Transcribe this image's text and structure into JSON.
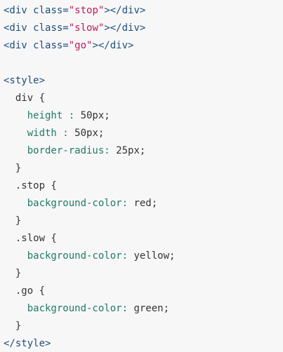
{
  "code": {
    "lines": [
      {
        "indent": "",
        "tag_open": "<div ",
        "attr": "class=",
        "string": "\"stop\"",
        "tag_close": "></div>"
      },
      {
        "indent": "",
        "tag_open": "<div ",
        "attr": "class=",
        "string": "\"slow\"",
        "tag_close": "></div>"
      },
      {
        "indent": "",
        "tag_open": "<div ",
        "attr": "class=",
        "string": "\"go\"",
        "tag_close": "></div>"
      },
      {
        "indent": "",
        "text": ""
      },
      {
        "indent": "",
        "text": "<style>"
      },
      {
        "indent": "  ",
        "selector": "div {"
      },
      {
        "indent": "    ",
        "prop": "height : ",
        "value": "50px;"
      },
      {
        "indent": "    ",
        "prop": "width : ",
        "value": "50px;"
      },
      {
        "indent": "    ",
        "prop": "border-radius: ",
        "value": "25px;"
      },
      {
        "indent": "  ",
        "brace": "}"
      },
      {
        "indent": "  ",
        "selector": ".stop {"
      },
      {
        "indent": "    ",
        "prop": "background-color: ",
        "value": "red;"
      },
      {
        "indent": "  ",
        "brace": "}"
      },
      {
        "indent": "  ",
        "selector": ".slow {"
      },
      {
        "indent": "    ",
        "prop": "background-color: ",
        "value": "yellow;"
      },
      {
        "indent": "  ",
        "brace": "}"
      },
      {
        "indent": "  ",
        "selector": ".go {"
      },
      {
        "indent": "    ",
        "prop": "background-color: ",
        "value": "green;"
      },
      {
        "indent": "  ",
        "brace": "}"
      },
      {
        "indent": "",
        "text": "</style>"
      }
    ]
  },
  "colors": {
    "background": "#f7f7f8",
    "tag": "#1f4e79",
    "string": "#c2185b",
    "property": "#1f7a64",
    "plain": "#333333"
  }
}
